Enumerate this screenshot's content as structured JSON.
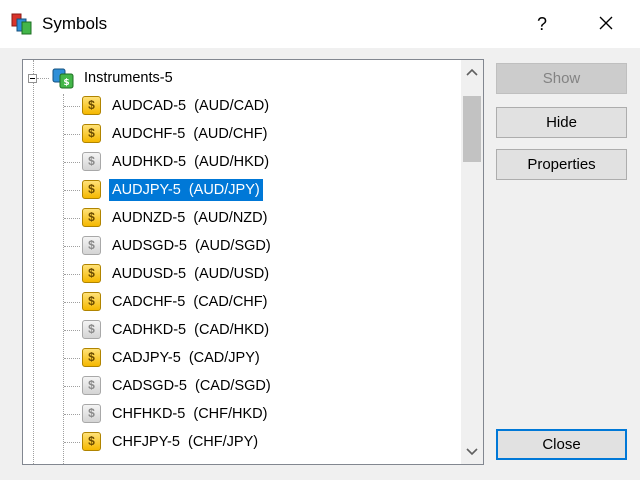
{
  "window": {
    "title": "Symbols",
    "help_label": "?"
  },
  "tree": {
    "root_label": "Instruments-5",
    "items": [
      {
        "label": "AUDCAD-5  (AUD/CAD)",
        "enabled": true,
        "selected": false
      },
      {
        "label": "AUDCHF-5  (AUD/CHF)",
        "enabled": true,
        "selected": false
      },
      {
        "label": "AUDHKD-5  (AUD/HKD)",
        "enabled": false,
        "selected": false
      },
      {
        "label": "AUDJPY-5  (AUD/JPY)",
        "enabled": true,
        "selected": true
      },
      {
        "label": "AUDNZD-5  (AUD/NZD)",
        "enabled": true,
        "selected": false
      },
      {
        "label": "AUDSGD-5  (AUD/SGD)",
        "enabled": false,
        "selected": false
      },
      {
        "label": "AUDUSD-5  (AUD/USD)",
        "enabled": true,
        "selected": false
      },
      {
        "label": "CADCHF-5  (CAD/CHF)",
        "enabled": true,
        "selected": false
      },
      {
        "label": "CADHKD-5  (CAD/HKD)",
        "enabled": false,
        "selected": false
      },
      {
        "label": "CADJPY-5  (CAD/JPY)",
        "enabled": true,
        "selected": false
      },
      {
        "label": "CADSGD-5  (CAD/SGD)",
        "enabled": false,
        "selected": false
      },
      {
        "label": "CHFHKD-5  (CHF/HKD)",
        "enabled": false,
        "selected": false
      },
      {
        "label": "CHFJPY-5  (CHF/JPY)",
        "enabled": true,
        "selected": false
      }
    ],
    "icon_glyph": "$"
  },
  "buttons": {
    "show": "Show",
    "hide": "Hide",
    "properties": "Properties",
    "close": "Close"
  },
  "colors": {
    "selection": "#0078d7",
    "enabled_icon": "#f5b800",
    "disabled_icon": "#d4d4d4"
  }
}
